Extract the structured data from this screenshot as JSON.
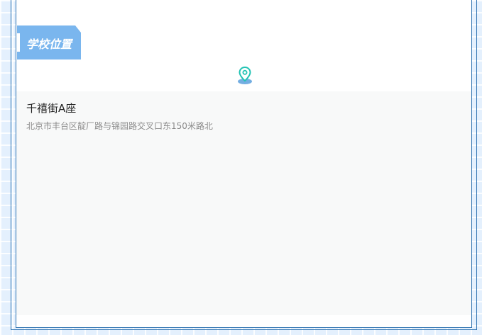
{
  "section": {
    "title": "学校位置"
  },
  "location": {
    "name": "千禧街A座",
    "address": "北京市丰台区靛厂路与锦园路交叉口东150米路北"
  },
  "icons": {
    "pin": "map-pin-icon"
  },
  "colors": {
    "frame_border": "#2f73b1",
    "title_tag": "#7ab6ee",
    "pin_stroke": "#22c3b4",
    "pin_shadow": "#74aee2",
    "card_background": "#f8f9f9"
  }
}
